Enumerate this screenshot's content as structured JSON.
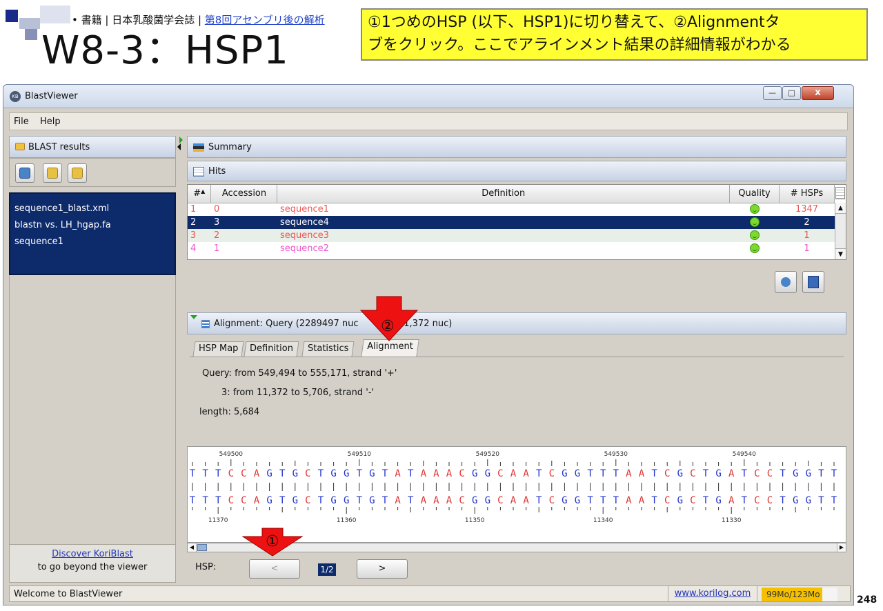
{
  "slide": {
    "breadcrumb_prefix": "• 書籍 | 日本乳酸菌学会誌 | ",
    "breadcrumb_link": "第8回アセンブリ後の解析",
    "title": "W8-3：HSP1",
    "callout_line1": "①1つめのHSP (以下、HSP1)に切り替えて、②Alignmentタ",
    "callout_line2": "ブをクリック。ここでアラインメント結果の詳細情報がわかる",
    "page_number": "248"
  },
  "window": {
    "title": "BlastViewer",
    "app_icon_text": "KB",
    "btn_min": "—",
    "btn_max": "□",
    "btn_close": "X"
  },
  "menu": {
    "file": "File",
    "help": "Help"
  },
  "left_panel": {
    "header": "BLAST results",
    "list": [
      "sequence1_blast.xml",
      "blastn vs. LH_hgap.fa",
      "sequence1"
    ],
    "discover_link": "Discover KoriBlast",
    "discover_text": "to go beyond the viewer"
  },
  "summary": {
    "header": "Summary",
    "hits_header": "Hits"
  },
  "hits_table": {
    "columns": [
      "#",
      "Accession",
      "Definition",
      "Quality",
      "# HSPs"
    ],
    "rows": [
      {
        "num": "1",
        "accession": "0",
        "definition": "sequence1",
        "hsps": "1347",
        "style": "r-red"
      },
      {
        "num": "2",
        "accession": "3",
        "definition": "sequence4",
        "hsps": "2",
        "style": "r-sel"
      },
      {
        "num": "3",
        "accession": "2",
        "definition": "sequence3",
        "hsps": "1",
        "style": "r-red r-alt"
      },
      {
        "num": "4",
        "accession": "1",
        "definition": "sequence2",
        "hsps": "1",
        "style": "r-pink"
      }
    ]
  },
  "alignment": {
    "header_left": "Alignment: Query (2289497 nuc",
    "header_right": "3 (11,372 nuc)",
    "tabs": [
      "HSP Map",
      "Definition",
      "Statistics",
      "Alignment"
    ],
    "active_tab": "Alignment",
    "query_line": "Query: from 549,494 to 555,171, strand '+'",
    "hit_line": "3: from 11,372 to 5,706, strand '-'",
    "length_line": "length: 5,684",
    "top_ruler": [
      "549500",
      "549510",
      "549520",
      "549530",
      "549540"
    ],
    "bottom_ruler": [
      "11370",
      "11360",
      "11350",
      "11340",
      "11330"
    ],
    "query_seq": "TTTCCAGTGCTGGTGTATAAACGGCAATCGGTTTAATCGCTGATCCTGGTT",
    "subject_seq": "TTTCCAGTGCTGGTGTATAAACGGCAATCGGTTTAATCGCTGATCCTGGTT",
    "base_colors": {
      "A": "#e03030",
      "C": "#e03030",
      "T": "#2233cc",
      "G": "#2233cc"
    }
  },
  "hsp_nav": {
    "label": "HSP:",
    "prev": "<",
    "page": "1/2",
    "next": ">"
  },
  "status": {
    "text": "Welcome to BlastViewer",
    "link": "www.korilog.com",
    "memory": "99Mo/123Mo",
    "memory_used_fraction": 0.8
  },
  "annotations": {
    "marker1": "①",
    "marker2": "②"
  }
}
